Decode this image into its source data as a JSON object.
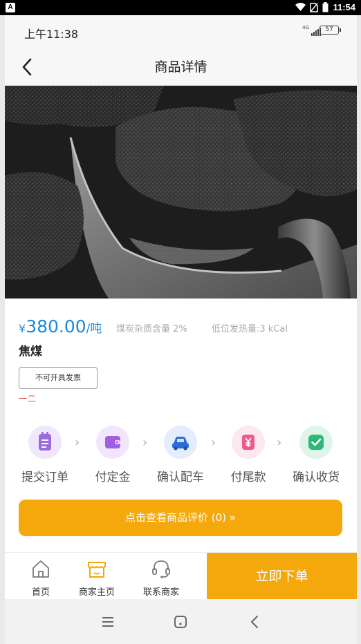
{
  "host_status": {
    "time": "11:54",
    "app_badge": "A"
  },
  "status": {
    "time": "上午11:38",
    "network": "4G",
    "battery": "57"
  },
  "nav": {
    "title": "商品详情"
  },
  "product": {
    "currency": "¥",
    "price": "380.00",
    "unit": "/吨",
    "spec_impurity": "煤炭杂质含量 2%",
    "spec_heat": "低位发热量:3 kCal",
    "name": "焦煤",
    "invoice_label": "不可开具发票",
    "tag": "一二"
  },
  "steps": [
    {
      "label": "提交订单",
      "icon": "clipboard-icon",
      "color": "#9c6ade",
      "bg": "#efe7fb"
    },
    {
      "label": "付定金",
      "icon": "wallet-icon",
      "color": "#a05ee0",
      "bg": "#f1e6fb"
    },
    {
      "label": "确认配车",
      "icon": "car-icon",
      "color": "#2e6ad6",
      "bg": "#e3edfb"
    },
    {
      "label": "付尾款",
      "icon": "yen-tag-icon",
      "color": "#f05a8a",
      "bg": "#fde8ef"
    },
    {
      "label": "确认收货",
      "icon": "check-icon",
      "color": "#2db87a",
      "bg": "#dff5ea"
    }
  ],
  "review": {
    "label": "点击查看商品评价 (0) »"
  },
  "bottom_tabs": [
    {
      "label": "首页",
      "icon": "home-icon"
    },
    {
      "label": "商家主页",
      "icon": "shop-icon"
    },
    {
      "label": "联系商家",
      "icon": "headset-icon"
    }
  ],
  "order_button": "立即下单",
  "colors": {
    "accent": "#f5a80b",
    "price": "#1e88d6",
    "tag": "#e74c3c"
  }
}
